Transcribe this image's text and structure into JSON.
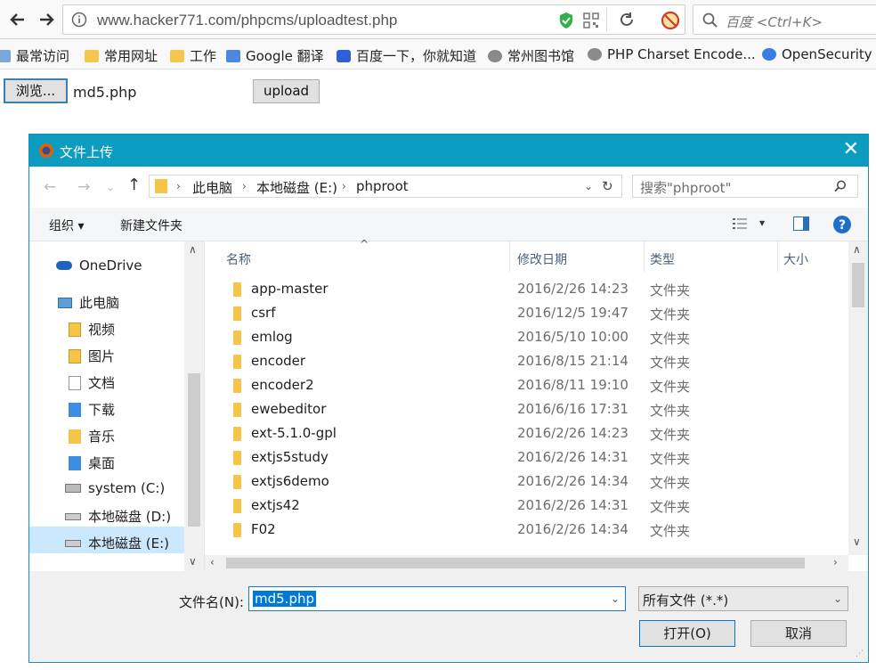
{
  "browser": {
    "url": "www.hacker771.com/phpcms/uploadtest.php",
    "search_placeholder": "百度 <Ctrl+K>"
  },
  "bookmarks": [
    {
      "label": "最常访问",
      "icon": "bookmark-icon"
    },
    {
      "label": "常用网址",
      "icon": "folder-icon"
    },
    {
      "label": "工作",
      "icon": "folder-icon"
    },
    {
      "label": "Google 翻译",
      "icon": "google-translate-icon"
    },
    {
      "label": "百度一下，你就知道",
      "icon": "baidu-paw-icon"
    },
    {
      "label": "常州图书馆",
      "icon": "globe-icon"
    },
    {
      "label": "PHP Charset Encode...",
      "icon": "globe-icon"
    },
    {
      "label": "OpenSecurity -",
      "icon": "google-g-icon"
    }
  ],
  "page": {
    "browse_label": "浏览...",
    "file_name": "md5.php",
    "upload_label": "upload"
  },
  "dialog": {
    "title": "文件上传",
    "breadcrumb": [
      "此电脑",
      "本地磁盘 (E:)",
      "phproot"
    ],
    "search_placeholder": "搜索\"phproot\"",
    "organize_label": "组织 ▾",
    "new_folder_label": "新建文件夹",
    "nav": [
      {
        "label": "OneDrive",
        "icon": "cloud-icon"
      },
      {
        "label": "此电脑",
        "icon": "computer-icon"
      },
      {
        "label": "视频",
        "icon": "video-icon"
      },
      {
        "label": "图片",
        "icon": "pictures-icon"
      },
      {
        "label": "文档",
        "icon": "documents-icon"
      },
      {
        "label": "下载",
        "icon": "downloads-icon"
      },
      {
        "label": "音乐",
        "icon": "music-icon"
      },
      {
        "label": "桌面",
        "icon": "desktop-icon"
      },
      {
        "label": "system (C:)",
        "icon": "drive-icon"
      },
      {
        "label": "本地磁盘 (D:)",
        "icon": "drive-icon"
      },
      {
        "label": "本地磁盘 (E:)",
        "icon": "drive-icon"
      }
    ],
    "columns": [
      "名称",
      "修改日期",
      "类型",
      "大小"
    ],
    "files": [
      {
        "name": "app-master",
        "date": "2016/2/26 14:23",
        "type": "文件夹"
      },
      {
        "name": "csrf",
        "date": "2016/12/5 19:47",
        "type": "文件夹"
      },
      {
        "name": "emlog",
        "date": "2016/5/10 10:00",
        "type": "文件夹"
      },
      {
        "name": "encoder",
        "date": "2016/8/15 21:14",
        "type": "文件夹"
      },
      {
        "name": "encoder2",
        "date": "2016/8/11 19:10",
        "type": "文件夹"
      },
      {
        "name": "ewebeditor",
        "date": "2016/6/16 17:31",
        "type": "文件夹"
      },
      {
        "name": "ext-5.1.0-gpl",
        "date": "2016/2/26 14:23",
        "type": "文件夹"
      },
      {
        "name": "extjs5study",
        "date": "2016/2/26 14:31",
        "type": "文件夹"
      },
      {
        "name": "extjs6demo",
        "date": "2016/2/26 14:34",
        "type": "文件夹"
      },
      {
        "name": "extjs42",
        "date": "2016/2/26 14:31",
        "type": "文件夹"
      },
      {
        "name": "F02",
        "date": "2016/2/26 14:34",
        "type": "文件夹"
      }
    ],
    "filename_label": "文件名(N):",
    "filename_value": "md5.php",
    "filetype_value": "所有文件 (*.*)",
    "open_label": "打开(O)",
    "cancel_label": "取消"
  },
  "colors": {
    "titlebar": "#0b9cc0",
    "selection": "#0078d7",
    "nav_selected": "#cce8ff"
  }
}
